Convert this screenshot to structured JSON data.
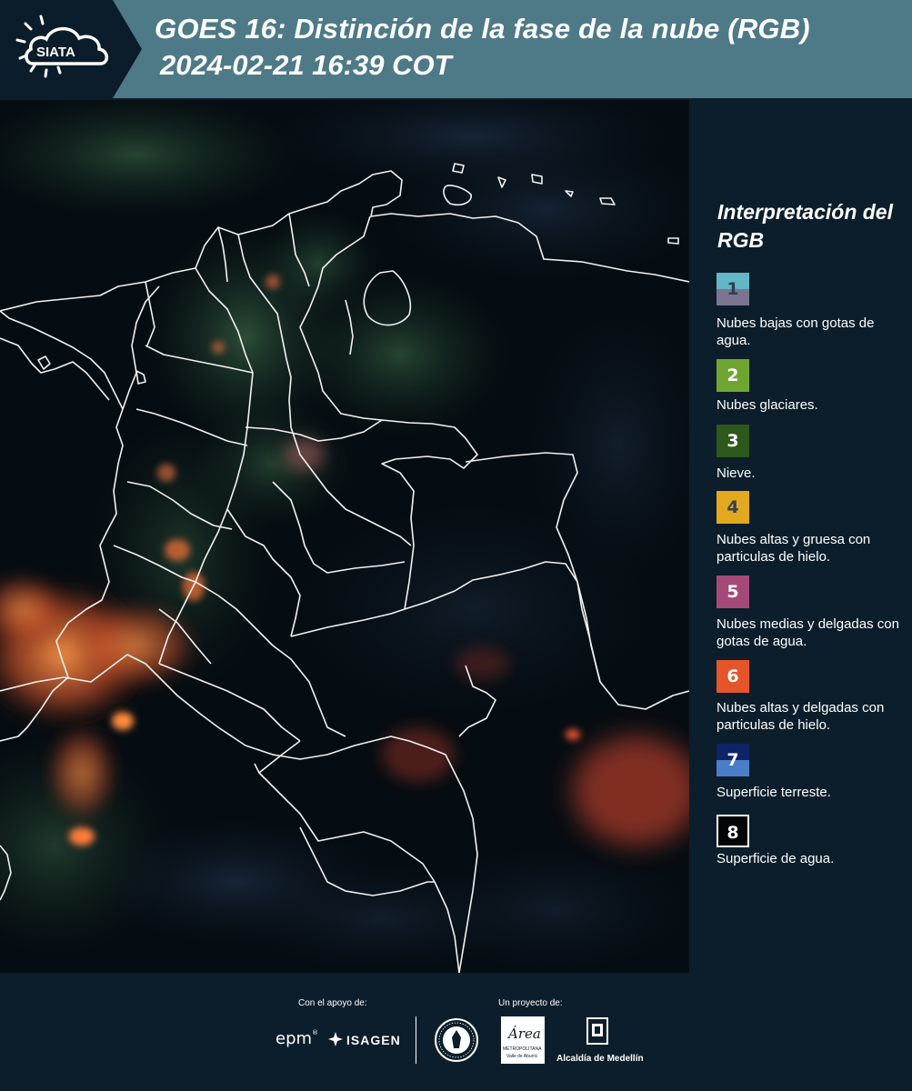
{
  "header": {
    "logo_text": "SIATA",
    "title_line1": "GOES 16: Distinción de la fase de la nube (RGB)",
    "title_line2": "2024-02-21 16:39 COT",
    "band_color": "#4e7a88"
  },
  "legend": {
    "title": "Interpretación del RGB",
    "items": [
      {
        "number": "1",
        "label": "Nubes bajas con gotas de agua.",
        "colors": [
          "#63b6c6",
          "#7b7592"
        ],
        "text_color": "#33404a"
      },
      {
        "number": "2",
        "label": "Nubes glaciares.",
        "colors": [
          "#6fa632",
          "#6fa632"
        ],
        "text_color": "#ffffff"
      },
      {
        "number": "3",
        "label": "Nieve.",
        "colors": [
          "#2d5a1c",
          "#2d5a1c"
        ],
        "text_color": "#ffffff"
      },
      {
        "number": "4",
        "label": "Nubes altas y gruesa con particulas de hielo.",
        "colors": [
          "#e2a81e",
          "#e2a81e"
        ],
        "text_color": "#33404a"
      },
      {
        "number": "5",
        "label": "Nubes medias y delgadas con gotas de agua.",
        "colors": [
          "#a44a78",
          "#a44a78"
        ],
        "text_color": "#ffffff"
      },
      {
        "number": "6",
        "label": "Nubes altas y delgadas con particulas de hielo.",
        "colors": [
          "#e4562a",
          "#e4562a"
        ],
        "text_color": "#ffffff"
      },
      {
        "number": "7",
        "label": "Superficie terreste.",
        "colors": [
          "#0f2466",
          "#4a7ec8"
        ],
        "text_color": "#ffffff"
      },
      {
        "number": "8",
        "label": "Superficie de agua.",
        "colors": [
          "#020606",
          "#020606"
        ],
        "text_color": "#ffffff"
      }
    ]
  },
  "footer": {
    "support_caption": "Con el apoyo de:",
    "project_caption": "Un proyecto de:",
    "sponsor1": "epm",
    "sponsor2": "ISAGEN",
    "partner_area": "Área",
    "partner_area_sub": "METROPOLITANA",
    "partner_area_sub2": "Valle de Aburrá",
    "partner_alcaldia": "Alcaldía de Medellín"
  }
}
